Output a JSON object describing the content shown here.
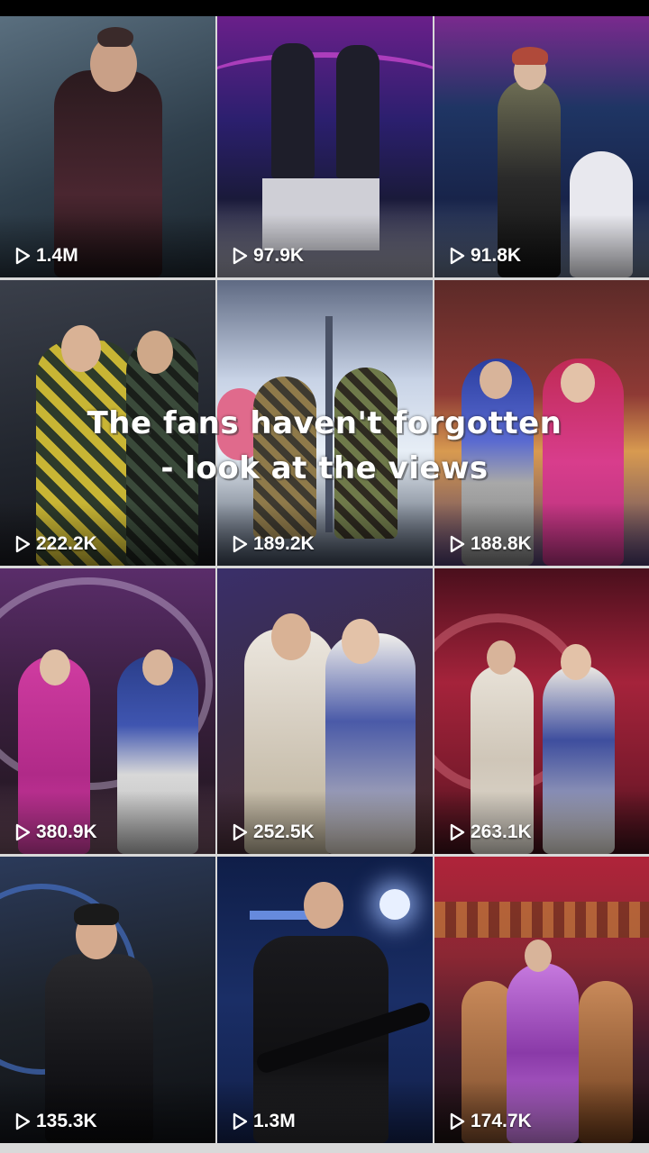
{
  "caption": "The fans haven't forgotten - look at the views",
  "tiles": [
    {
      "views": "1.4M",
      "bg": "#3b4d5c",
      "accent": "#9fb9c9"
    },
    {
      "views": "97.9K",
      "bg": "#2b1f6e",
      "accent": "#b23cc1"
    },
    {
      "views": "91.8K",
      "bg": "#18244a",
      "accent": "#3f8fd1"
    },
    {
      "views": "222.2K",
      "bg": "#22262e",
      "accent": "#d8c93a"
    },
    {
      "views": "189.2K",
      "bg": "#c8d3e6",
      "accent": "#e06a8c"
    },
    {
      "views": "188.8K",
      "bg": "#7e2a2a",
      "accent": "#d83d8c"
    },
    {
      "views": "380.9K",
      "bg": "#3a1f3f",
      "accent": "#d03ca1"
    },
    {
      "views": "252.5K",
      "bg": "#3b2c46",
      "accent": "#ece7df"
    },
    {
      "views": "263.1K",
      "bg": "#a5233b",
      "accent": "#e8e2d8"
    },
    {
      "views": "135.3K",
      "bg": "#1d2229",
      "accent": "#6b88b0"
    },
    {
      "views": "1.3M",
      "bg": "#1a2e66",
      "accent": "#4b7be0"
    },
    {
      "views": "174.7K",
      "bg": "#8a2733",
      "accent": "#c77adf"
    }
  ]
}
